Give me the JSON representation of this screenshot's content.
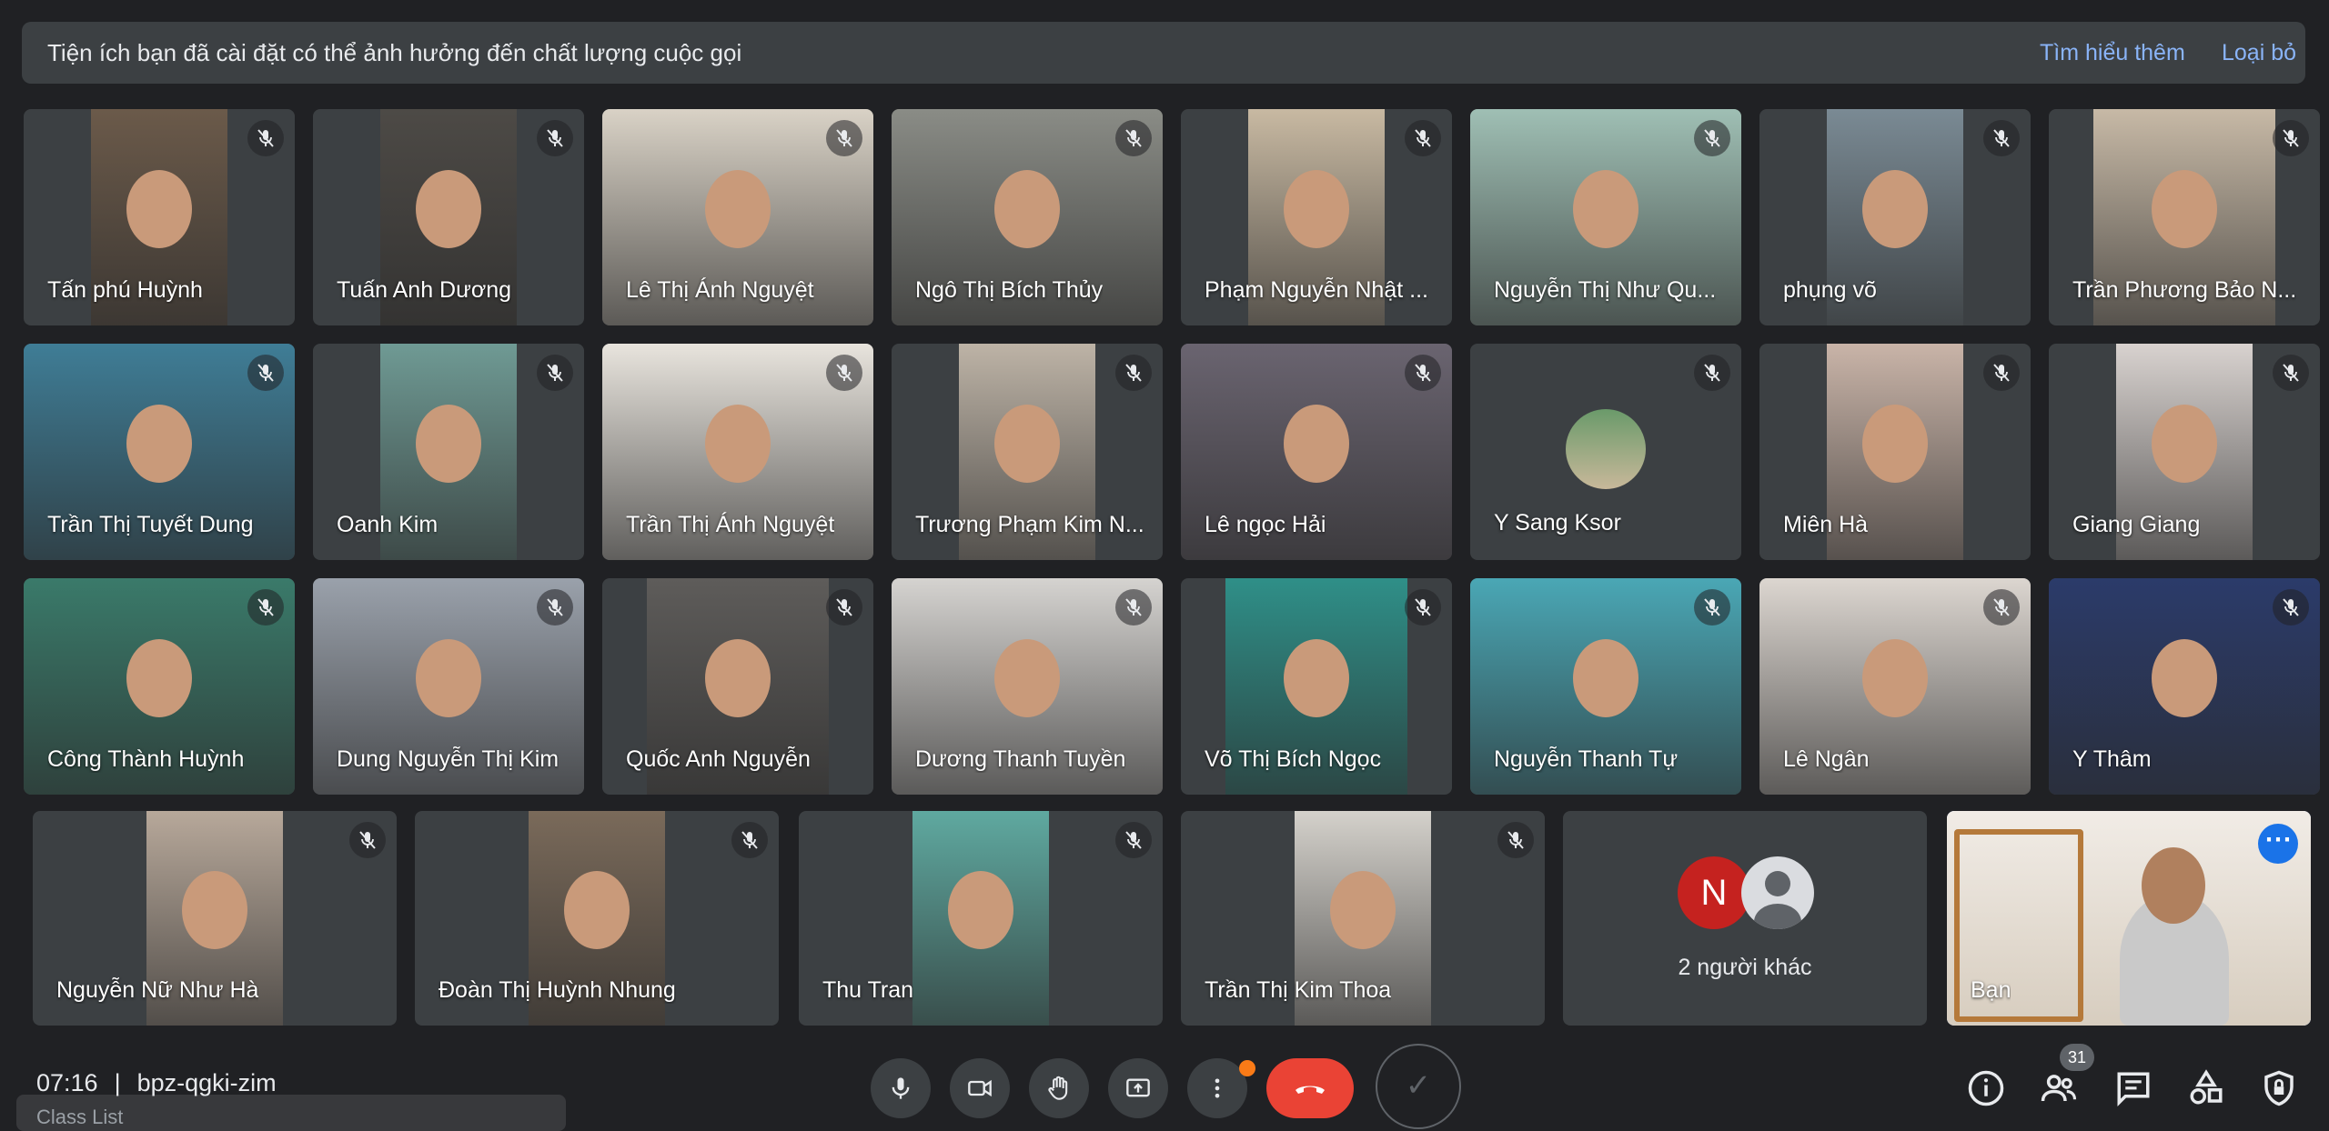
{
  "banner": {
    "message": "Tiện ích bạn đã cài đặt có thể ảnh hưởng đến chất lượng cuộc gọi",
    "learn_more": "Tìm hiểu thêm",
    "dismiss": "Loại bỏ"
  },
  "participants": [
    {
      "name": "Tấn phú Huỳnh",
      "muted": true
    },
    {
      "name": "Tuấn Anh Dương",
      "muted": true
    },
    {
      "name": "Lê Thị Ánh Nguyệt",
      "muted": true
    },
    {
      "name": "Ngô Thị Bích Thủy",
      "muted": true
    },
    {
      "name": "Phạm Nguyễn Nhật ...",
      "muted": true
    },
    {
      "name": "Nguyễn Thị Như Qu...",
      "muted": true
    },
    {
      "name": "phụng võ",
      "muted": true
    },
    {
      "name": "Trần Phương Bảo N...",
      "muted": true
    },
    {
      "name": "Trần Thị Tuyết Dung",
      "muted": true
    },
    {
      "name": "Oanh Kim",
      "muted": true
    },
    {
      "name": "Trần Thị Ánh Nguyệt",
      "muted": true
    },
    {
      "name": "Trương Phạm Kim N...",
      "muted": true
    },
    {
      "name": "Lê ngọc Hải",
      "muted": true
    },
    {
      "name": "Y Sang Ksor",
      "muted": true
    },
    {
      "name": "Miên Hà",
      "muted": true
    },
    {
      "name": "Giang Giang",
      "muted": true
    },
    {
      "name": "Công Thành Huỳnh",
      "muted": true
    },
    {
      "name": "Dung Nguyễn Thị Kim",
      "muted": true
    },
    {
      "name": "Quốc Anh Nguyễn",
      "muted": true
    },
    {
      "name": "Dương Thanh Tuyền",
      "muted": true
    },
    {
      "name": "Võ Thị Bích Ngọc",
      "muted": true
    },
    {
      "name": "Nguyễn Thanh Tự",
      "muted": true
    },
    {
      "name": "Lê Ngân",
      "muted": true
    },
    {
      "name": "Y Thâm",
      "muted": true
    },
    {
      "name": "Nguyễn Nữ Như Hà",
      "muted": true
    },
    {
      "name": "Đoàn Thị Huỳnh Nhung",
      "muted": true
    },
    {
      "name": "Thu Tran",
      "muted": true
    },
    {
      "name": "Trần Thị Kim Thoa",
      "muted": true
    }
  ],
  "others_tile": {
    "initial": "N",
    "label": "2 người khác"
  },
  "self_tile": {
    "name": "Bạn",
    "more_icon": "more-horiz-icon"
  },
  "meeting": {
    "time": "07:16",
    "separator": "|",
    "code": "bpz-qgki-zim"
  },
  "participant_count": "31",
  "overlay": {
    "text": "Class List"
  },
  "colors": {
    "accent": "#8ab4f8",
    "end_call": "#ea4335",
    "badge": "#fa7b17",
    "tile": "#3c4043",
    "background": "#202124"
  }
}
